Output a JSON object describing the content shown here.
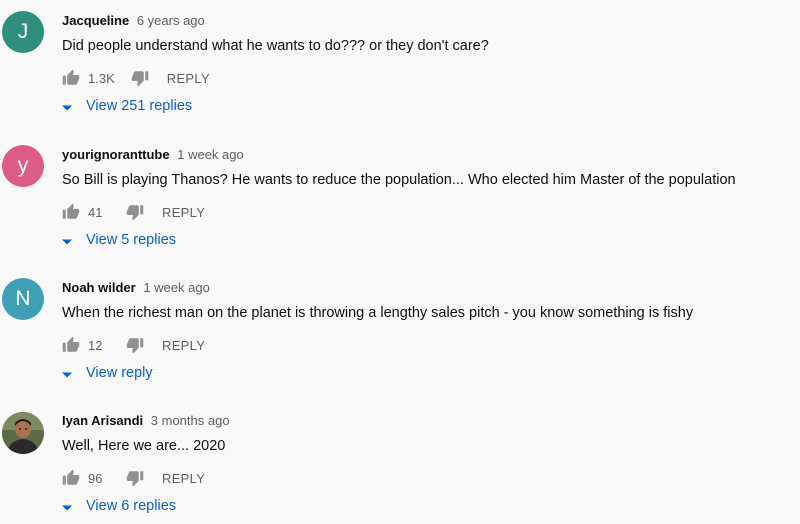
{
  "colors": {
    "link": "#065fd4",
    "meta": "#606060",
    "avatar_j": "#2f8f7e",
    "avatar_y": "#dd5c86",
    "avatar_n": "#3ea0b5"
  },
  "comments": [
    {
      "avatar_letter": "J",
      "author": "Jacqueline",
      "time": "6 years ago",
      "text": "Did people understand what he wants to do??? or they don't care?",
      "likes": "1.3K",
      "reply_label": "REPLY",
      "view_replies": "View 251 replies"
    },
    {
      "avatar_letter": "y",
      "author": "yourignoranttube",
      "time": "1 week ago",
      "text": "So Bill is playing Thanos? He wants to reduce the population... Who elected him Master of the population",
      "likes": "41",
      "reply_label": "REPLY",
      "view_replies": "View 5 replies"
    },
    {
      "avatar_letter": "N",
      "author": "Noah wilder",
      "time": "1 week ago",
      "text": "When the richest man on the planet is throwing a lengthy sales pitch - you know something is fishy",
      "likes": "12",
      "reply_label": "REPLY",
      "view_replies": "View reply"
    },
    {
      "avatar_letter": "",
      "author": "Iyan Arisandi",
      "time": "3 months ago",
      "text": "Well, Here we are... 2020",
      "likes": "96",
      "reply_label": "REPLY",
      "view_replies": "View 6 replies"
    }
  ]
}
